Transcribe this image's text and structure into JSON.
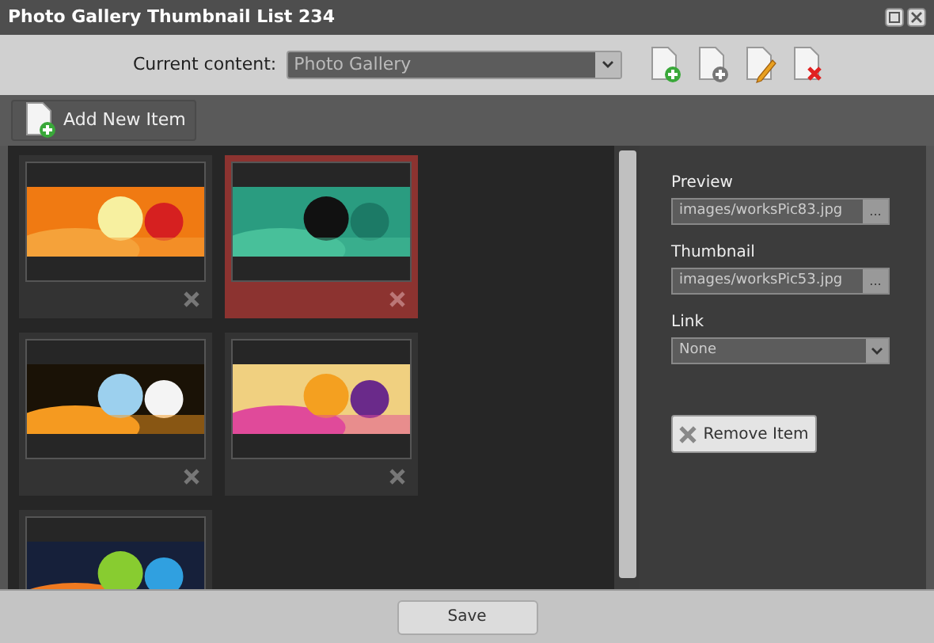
{
  "window": {
    "title": "Photo Gallery Thumbnail List 234"
  },
  "toolbar": {
    "label": "Current content:",
    "value": "Photo Gallery"
  },
  "add_button": {
    "label": "Add New Item"
  },
  "items": [
    {
      "kind": "picture",
      "selected": false
    },
    {
      "kind": "picture",
      "selected": true
    },
    {
      "kind": "picture",
      "selected": false
    },
    {
      "kind": "picture",
      "selected": false
    },
    {
      "kind": "picture",
      "selected": false
    }
  ],
  "details": {
    "fields": [
      {
        "label": "Preview",
        "value": "images/worksPic83.jpg",
        "kind": "browse",
        "button": "..."
      },
      {
        "label": "Thumbnail",
        "value": "images/worksPic53.jpg",
        "kind": "browse",
        "button": "..."
      },
      {
        "label": "Link",
        "value": "None",
        "kind": "select"
      }
    ],
    "remove_button": {
      "label": "Remove Item"
    }
  },
  "footer": {
    "save": "Save"
  }
}
